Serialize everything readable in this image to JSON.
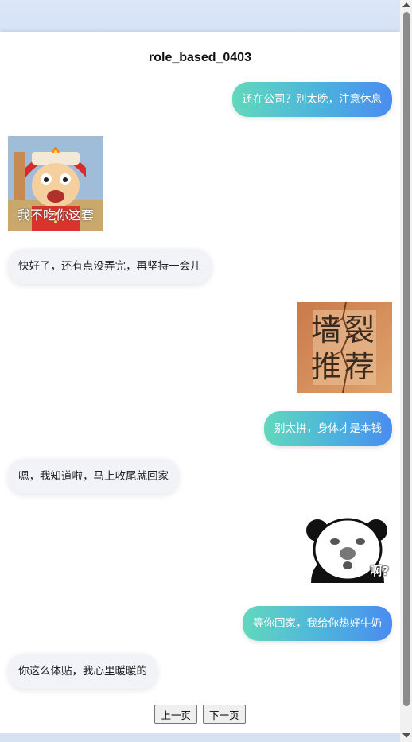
{
  "title": "role_based_0403",
  "messages": [
    {
      "side": "right",
      "type": "text",
      "text": "还在公司？别太晚，注意休息"
    },
    {
      "side": "left",
      "type": "sticker",
      "caption": "我不吃你这套",
      "icon": "cartoon-boy-angry-sticker"
    },
    {
      "side": "left",
      "type": "text",
      "text": "快好了，还有点没弄完，再坚持一会儿"
    },
    {
      "side": "right",
      "type": "sticker",
      "caption": "墙裂推荐",
      "icon": "wall-crack-recommend-sticker"
    },
    {
      "side": "right",
      "type": "text",
      "text": "别太拼，身体才是本钱"
    },
    {
      "side": "left",
      "type": "text",
      "text": "嗯，我知道啦，马上收尾就回家"
    },
    {
      "side": "right",
      "type": "sticker",
      "caption": "啊?",
      "icon": "panda-face-sticker"
    },
    {
      "side": "right",
      "type": "text",
      "text": "等你回家，我给你热好牛奶"
    },
    {
      "side": "left",
      "type": "text",
      "text": "你这么体贴，我心里暖暖的"
    }
  ],
  "pager": {
    "prev": "上一页",
    "next": "下一页"
  },
  "colors": {
    "out_start": "#62d8bd",
    "out_end": "#4a8cf0",
    "in_bg": "#f1f3f8"
  }
}
